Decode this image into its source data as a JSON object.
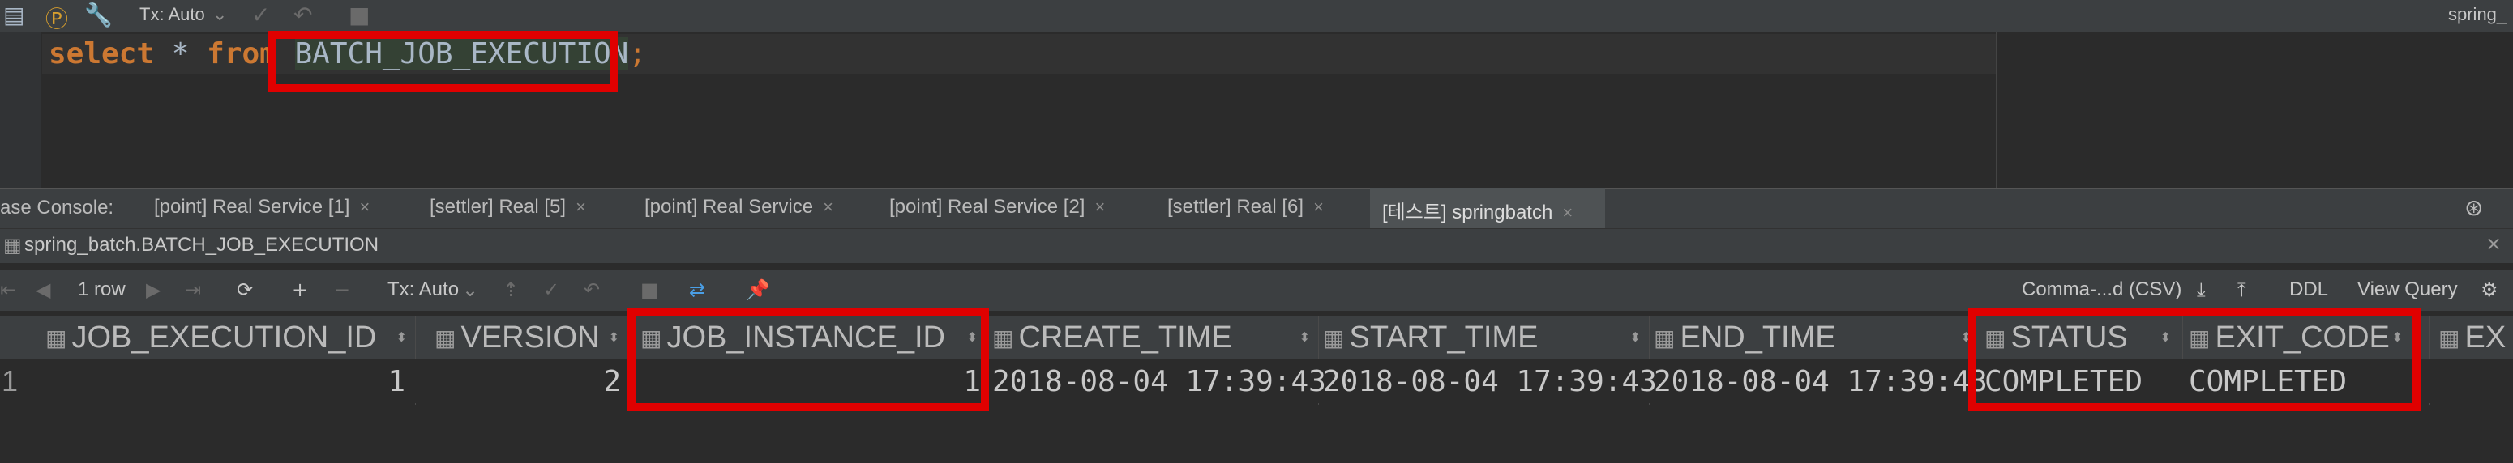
{
  "top_toolbar": {
    "tx_mode": "Tx: Auto",
    "project_name": "spring_"
  },
  "editor": {
    "kw_select": "select",
    "op_star": "*",
    "kw_from": "from",
    "table_name": "BATCH_JOB_EXECUTION",
    "semicolon": ";"
  },
  "console_tabs": {
    "label": "ase Console:",
    "tabs": [
      {
        "label": "[point] Real Service [1]"
      },
      {
        "label": "[settler] Real [5]"
      },
      {
        "label": "[point] Real Service"
      },
      {
        "label": "[point] Real Service [2]"
      },
      {
        "label": "[settler] Real [6]"
      },
      {
        "label": "[테스트] springbatch"
      }
    ],
    "close_glyph": "×"
  },
  "result": {
    "title": "spring_batch.BATCH_JOB_EXECUTION",
    "close_glyph": "×"
  },
  "result_toolbar": {
    "rows": "1 row",
    "tx_mode": "Tx: Auto",
    "export_format": "Comma-...d (CSV)",
    "ddl": "DDL",
    "view_query": "View Query"
  },
  "grid": {
    "columns": [
      "JOB_EXECUTION_ID",
      "VERSION",
      "JOB_INSTANCE_ID",
      "CREATE_TIME",
      "START_TIME",
      "END_TIME",
      "STATUS",
      "EXIT_CODE",
      "EX"
    ],
    "row_number": "1",
    "row": [
      "1",
      "2",
      "1",
      "2018-08-04 17:39:43",
      "2018-08-04 17:39:43",
      "2018-08-04 17:39:43",
      "COMPLETED",
      "COMPLETED"
    ]
  },
  "colors": {
    "highlight": "#e00000",
    "keyword": "#cc7832",
    "background": "#2b2b2b",
    "panel": "#3c3f41"
  }
}
